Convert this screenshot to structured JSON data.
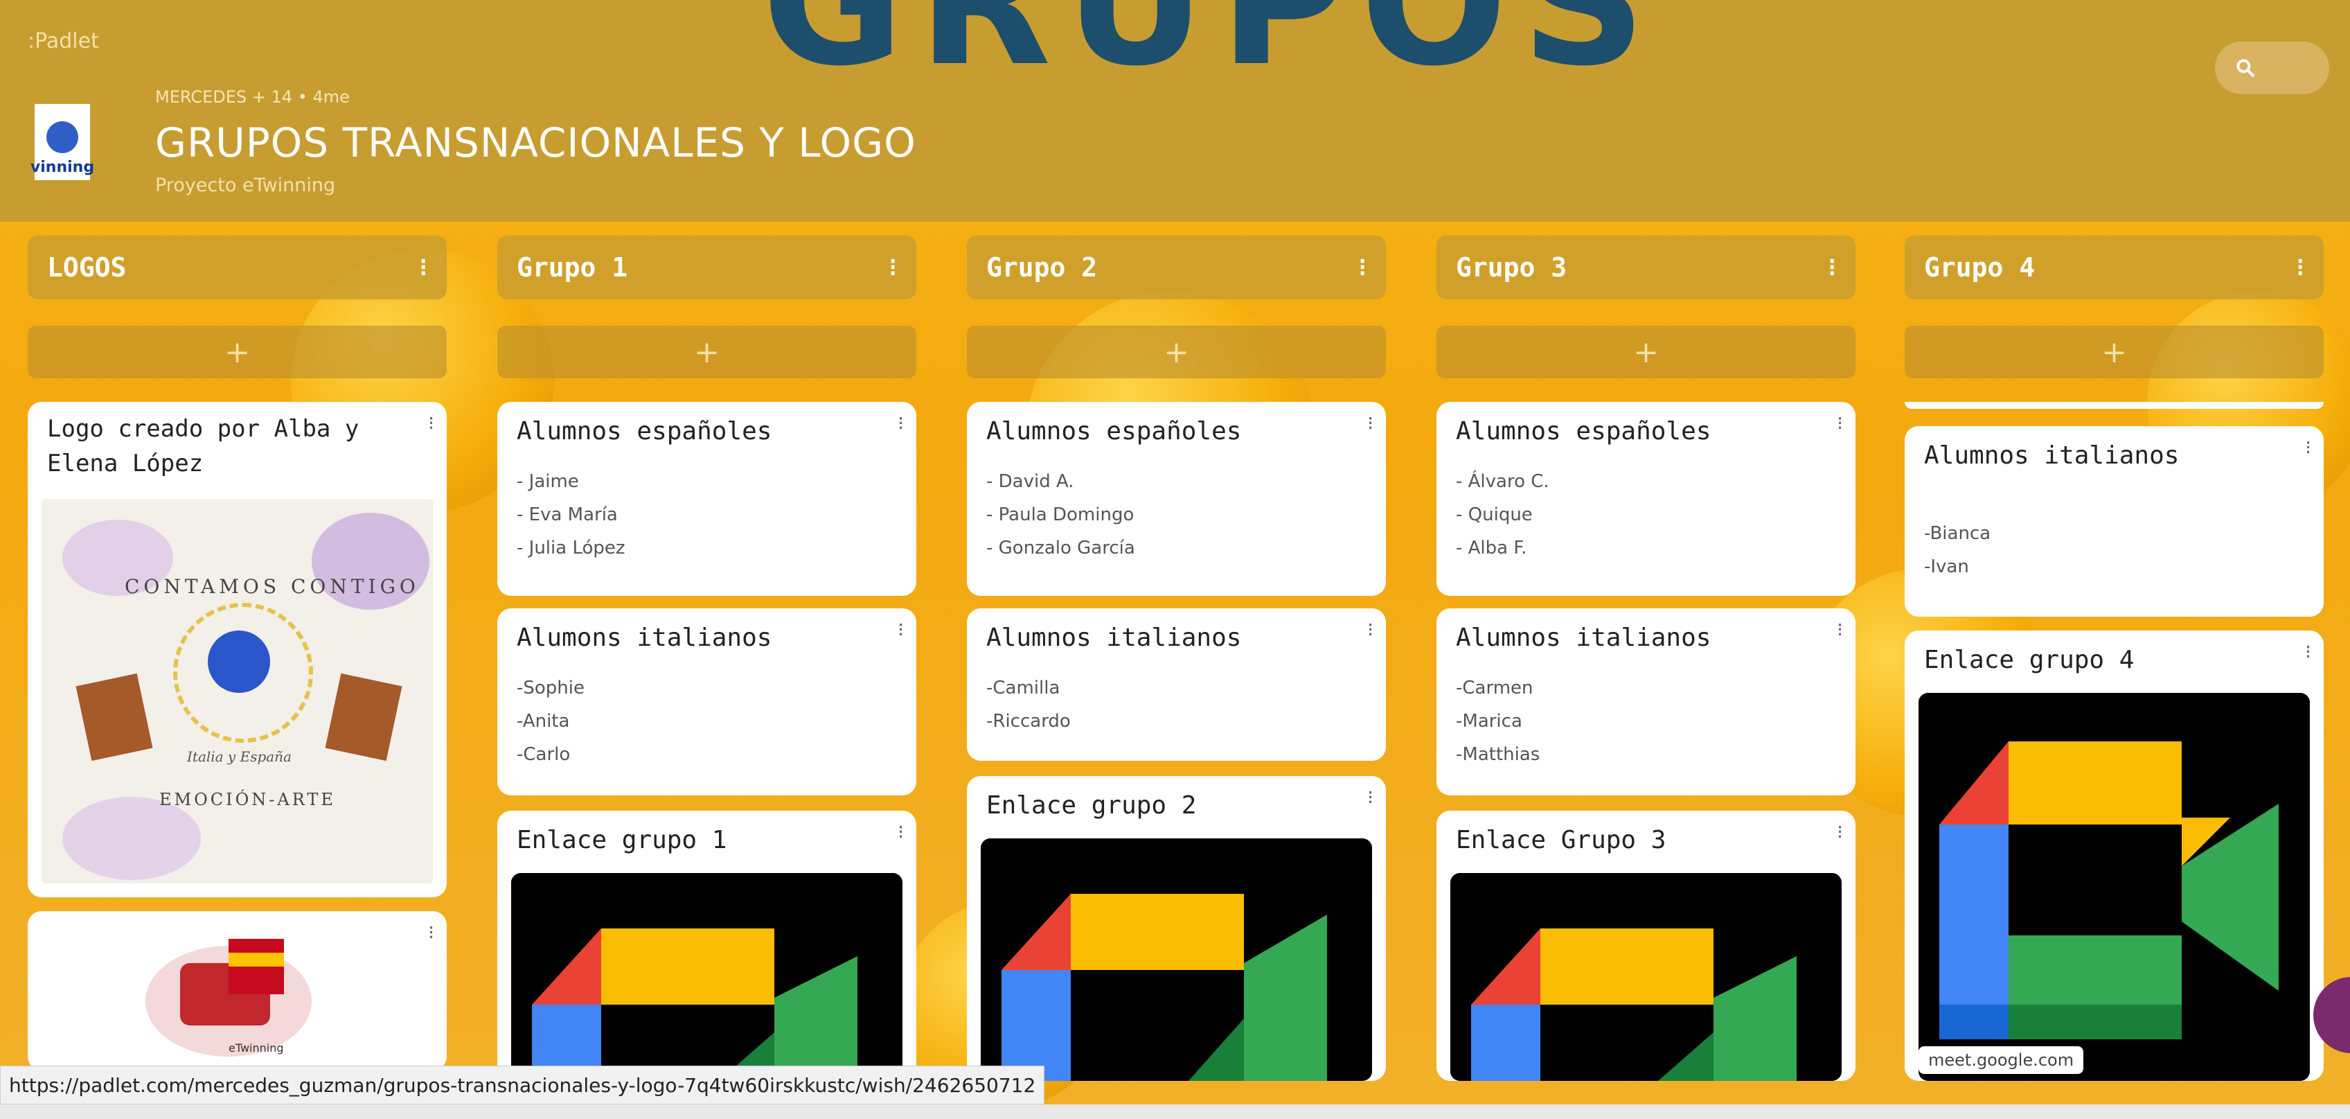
{
  "header": {
    "brand": ":Padlet",
    "big_title_fragment": "GRUPOS",
    "meta": "MERCEDES + 14 • 4me",
    "title": "GRUPOS TRANSNACIONALES Y LOGO",
    "subtitle": "Proyecto eTwinning",
    "logo_text": "vinning"
  },
  "columns": [
    {
      "title": "LOGOS",
      "add": "+"
    },
    {
      "title": "Grupo 1",
      "add": "+"
    },
    {
      "title": "Grupo 2",
      "add": "+"
    },
    {
      "title": "Grupo 3",
      "add": "+"
    },
    {
      "title": "Grupo 4",
      "add": "+"
    }
  ],
  "cards": {
    "logo1_title": "Logo creado por Alba y Elena López",
    "logo_img_text_top": "CONTAMOS CONTIGO",
    "logo_img_text_mid": "Italia y España",
    "logo_img_text_bottom": "EMOCIÓN-ARTE",
    "g1_es_title": "Alumnos españoles",
    "g1_es_lines": [
      "- Jaime",
      "- Eva María",
      "- Julia López"
    ],
    "g1_it_title": "Alumons italianos",
    "g1_it_lines": [
      "-Sophie",
      "-Anita",
      "-Carlo"
    ],
    "g1_link_title": "Enlace grupo 1",
    "g2_es_title": "Alumnos españoles",
    "g2_es_lines": [
      "- David A.",
      "- Paula Domingo",
      "- Gonzalo García"
    ],
    "g2_it_title": "Alumnos italianos",
    "g2_it_lines": [
      "-Camilla",
      "-Riccardo"
    ],
    "g2_link_title": "Enlace grupo 2",
    "g3_es_title": "Alumnos españoles",
    "g3_es_lines": [
      "- Álvaro C.",
      "- Quique",
      "- Alba F."
    ],
    "g3_it_title": "Alumnos italianos",
    "g3_it_lines": [
      "-Carmen",
      "-Marica",
      "-Matthias"
    ],
    "g3_link_title": "Enlace Grupo 3",
    "g4_it_title": "Alumnos italianos",
    "g4_it_lines": [
      "-Bianca",
      "-Ivan"
    ],
    "g4_link_title": "Enlace grupo 4",
    "g4_meet_caption": "meet.google.com",
    "etwinning_badge": "eTwinning"
  },
  "status_url": "https://padlet.com/mercedes_guzman/grupos-transnacionales-y-logo-7q4tw60irskkustc/wish/2462650712",
  "icons": {
    "search": "search-icon",
    "kebab": "kebab-icon",
    "add": "plus-icon"
  },
  "colors": {
    "header": "#c79c31",
    "title_fragment": "#1d4e6b",
    "background": "#f3a90f"
  }
}
